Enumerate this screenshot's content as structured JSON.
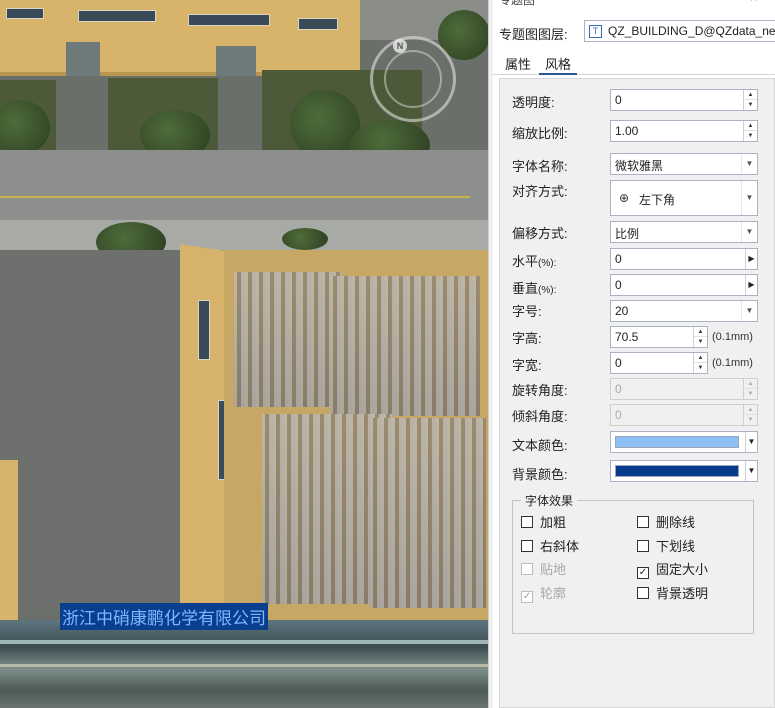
{
  "map": {
    "label": "浙江中硝康鹏化学有限公司",
    "compass_letter": "N"
  },
  "panel": {
    "title": "专题图",
    "close_glyph": "×",
    "layer_label": "专题图图层:",
    "layer_value": "QZ_BUILDING_D@QZdata_newsj",
    "tabs": [
      {
        "label": "属性",
        "active": false
      },
      {
        "label": "风格",
        "active": true
      }
    ]
  },
  "style": {
    "transparency": {
      "label": "透明度:",
      "value": "0"
    },
    "scale": {
      "label": "缩放比例:",
      "value": "1.00"
    },
    "font_name": {
      "label": "字体名称:",
      "value": "微软雅黑"
    },
    "alignment": {
      "label": "对齐方式:",
      "value": "左下角"
    },
    "offset_mode": {
      "label": "偏移方式:",
      "value": "比例"
    },
    "horizontal": {
      "label": "水平",
      "unit_suffix": "(%):",
      "value": "0"
    },
    "vertical": {
      "label": "垂直",
      "unit_suffix": "(%):",
      "value": "0"
    },
    "font_size": {
      "label": "字号:",
      "value": "20"
    },
    "font_height": {
      "label": "字高:",
      "value": "70.5",
      "unit": "(0.1mm)"
    },
    "font_width": {
      "label": "字宽:",
      "value": "0",
      "unit": "(0.1mm)"
    },
    "rotation": {
      "label": "旋转角度:",
      "value": "0",
      "disabled": true
    },
    "italic_angle": {
      "label": "倾斜角度:",
      "value": "0",
      "disabled": true
    },
    "text_color": {
      "label": "文本颜色:",
      "color": "#8ec0f5"
    },
    "bg_color": {
      "label": "背景颜色:",
      "color": "#063a8c"
    }
  },
  "effects": {
    "title": "字体效果",
    "items": [
      {
        "label": "加粗",
        "checked": false,
        "disabled": false
      },
      {
        "label": "删除线",
        "checked": false,
        "disabled": false
      },
      {
        "label": "右斜体",
        "checked": false,
        "disabled": false
      },
      {
        "label": "下划线",
        "checked": false,
        "disabled": false
      },
      {
        "label": "贴地",
        "checked": false,
        "disabled": true
      },
      {
        "label": "固定大小",
        "checked": true,
        "disabled": false
      },
      {
        "label": "轮廓",
        "checked": true,
        "disabled": true
      },
      {
        "label": "背景透明",
        "checked": false,
        "disabled": false
      }
    ]
  }
}
